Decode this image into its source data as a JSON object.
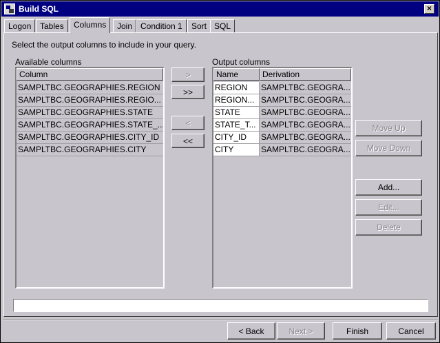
{
  "window": {
    "title": "Build SQL",
    "close_label": "×"
  },
  "tabs": [
    {
      "label": "Logon"
    },
    {
      "label": "Tables"
    },
    {
      "label": "Columns"
    },
    {
      "label": "Join"
    },
    {
      "label": "Condition 1"
    },
    {
      "label": "Sort"
    },
    {
      "label": "SQL"
    }
  ],
  "instruction": "Select the output columns to include in your query.",
  "available": {
    "label": "Available columns",
    "header": "Column",
    "rows": [
      "SAMPLTBC.GEOGRAPHIES.REGION",
      "SAMPLTBC.GEOGRAPHIES.REGIO...",
      "SAMPLTBC.GEOGRAPHIES.STATE",
      "SAMPLTBC.GEOGRAPHIES.STATE_...",
      "SAMPLTBC.GEOGRAPHIES.CITY_ID",
      "SAMPLTBC.GEOGRAPHIES.CITY"
    ]
  },
  "transfer": {
    "add_one": ">",
    "add_all": ">>",
    "remove_one": "<",
    "remove_all": "<<"
  },
  "output": {
    "label": "Output columns",
    "header_name": "Name",
    "header_derivation": "Derivation",
    "rows": [
      {
        "name": "REGION",
        "derivation": "SAMPLTBC.GEOGRA..."
      },
      {
        "name": "REGION...",
        "derivation": "SAMPLTBC.GEOGRA..."
      },
      {
        "name": "STATE",
        "derivation": "SAMPLTBC.GEOGRA..."
      },
      {
        "name": "STATE_T...",
        "derivation": "SAMPLTBC.GEOGRA..."
      },
      {
        "name": "CITY_ID",
        "derivation": "SAMPLTBC.GEOGRA..."
      },
      {
        "name": "CITY",
        "derivation": "SAMPLTBC.GEOGRA..."
      }
    ]
  },
  "side_buttons": {
    "move_up": "Move Up",
    "move_down": "Move Down",
    "add": "Add...",
    "edit": "Edit...",
    "delete": "Delete"
  },
  "footer": {
    "back": "< Back",
    "next": "Next >",
    "finish": "Finish",
    "cancel": "Cancel"
  }
}
